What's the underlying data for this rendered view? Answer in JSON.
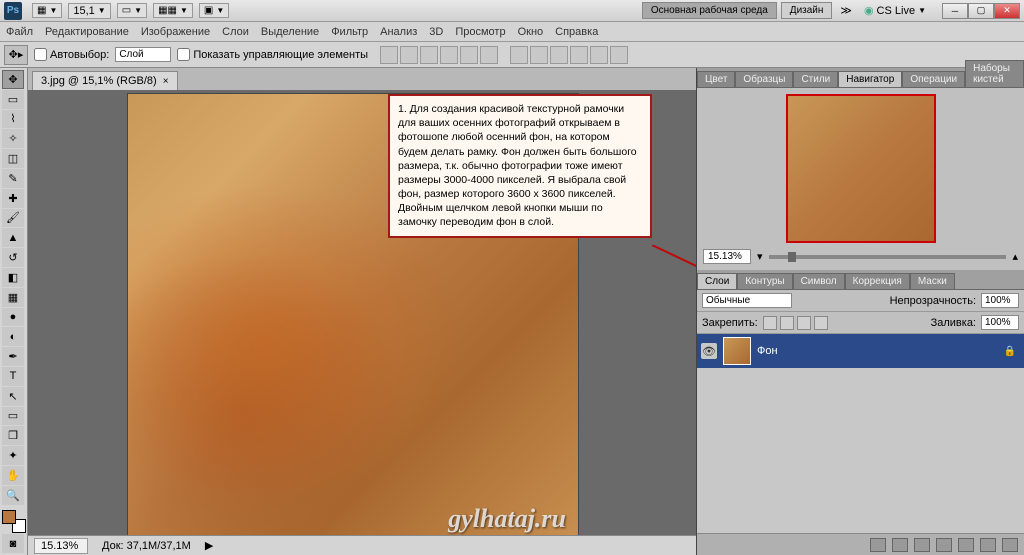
{
  "title": {
    "ps": "Ps",
    "zoom_dd": "15,1",
    "workspace_main": "Основная рабочая среда",
    "workspace_design": "Дизайн",
    "cslive": "CS Live"
  },
  "menu": [
    "Файл",
    "Редактирование",
    "Изображение",
    "Слои",
    "Выделение",
    "Фильтр",
    "Анализ",
    "3D",
    "Просмотр",
    "Окно",
    "Справка"
  ],
  "options": {
    "autoselect": "Автовыбор:",
    "autoselect_val": "Слой",
    "show_transform": "Показать управляющие элементы"
  },
  "doc": {
    "tab": "3.jpg @ 15,1% (RGB/8)",
    "watermark": "gylhataj.ru"
  },
  "annotation": "1. Для создания красивой текстурной рамочки для ваших осенних фотографий открываем в фотошопе любой осенний фон, на котором будем делать рамку. Фон должен быть большого размера, т.к. обычно фотографии тоже имеют размеры 3000-4000 пикселей. Я выбрала свой фон, размер которого 3600 х 3600 пикселей. Двойным щелчком левой кнопки мыши по замочку переводим фон в слой.",
  "status": {
    "zoom": "15.13%",
    "docinfo": "Док: 37,1M/37,1M"
  },
  "panel_top_tabs": [
    "Цвет",
    "Образцы",
    "Стили",
    "Навигатор",
    "Операции",
    "Наборы кистей"
  ],
  "panel_top_active": 3,
  "navigator": {
    "zoom": "15.13%"
  },
  "panel_bottom_tabs": [
    "Слои",
    "Контуры",
    "Символ",
    "Коррекция",
    "Маски"
  ],
  "panel_bottom_active": 0,
  "layers": {
    "blend": "Обычные",
    "opacity_label": "Непрозрачность:",
    "opacity": "100%",
    "lock_label": "Закрепить:",
    "fill_label": "Заливка:",
    "fill": "100%",
    "items": [
      {
        "name": "Фон"
      }
    ]
  }
}
